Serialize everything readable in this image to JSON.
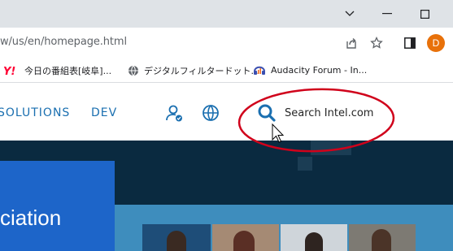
{
  "browser": {
    "url": "w/us/en/homepage.html",
    "profile_initial": "D",
    "bookmarks": [
      {
        "label": "今日の番組表[岐阜]...",
        "icon": "yahoo-icon"
      },
      {
        "label": "デジタルフィルタードット...",
        "icon": "globe-icon"
      },
      {
        "label": "Audacity Forum - In...",
        "icon": "audacity-icon"
      }
    ]
  },
  "site": {
    "nav": {
      "solutions": "SOLUTIONS",
      "dev": "DEV",
      "search_label": "Search Intel.com"
    },
    "hero": {
      "text": "ciation"
    }
  },
  "colors": {
    "accent": "#1a6fb0",
    "hero_bg": "#0a2a40",
    "hero_panel": "#1d65c9",
    "annotation": "#d0021b"
  }
}
